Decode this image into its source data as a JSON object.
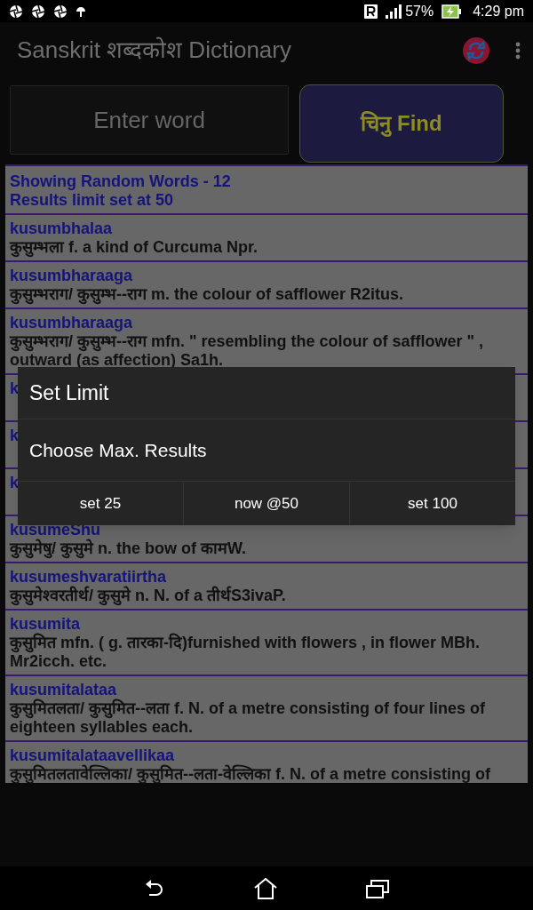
{
  "status_bar": {
    "battery": "57%",
    "time": "4:29 pm"
  },
  "app_bar": {
    "title": "Sanskrit शब्दकोश Dictionary"
  },
  "search": {
    "placeholder": "Enter word"
  },
  "find_button": {
    "label": "चिनु Find"
  },
  "results": {
    "header": [
      "Showing Random Words - 12",
      "Results limit set at 50"
    ],
    "items": [
      {
        "word": "kusumbhalaa",
        "definition": "कुसुम्भला f. a kind of Curcuma Npr."
      },
      {
        "word": "kusumbharaaga",
        "definition": "कुसुम्भराग/ कुसुम्भ--राग m. the colour of safflower R2itus."
      },
      {
        "word": "kusumbharaaga",
        "definition": "कुसुम्भराग/ कुसुम्भ--राग mfn. \" resembling the colour of safflower \" , outward (as affection) Sa1h."
      },
      {
        "word": "k"
      },
      {
        "word": "k"
      },
      {
        "word": "k"
      },
      {
        "word": "kusumeShu",
        "definition": "कुसुमेषु/ कुसुमे n. the bow of कामW."
      },
      {
        "word": "kusumeshvaratiirtha",
        "definition": "कुसुमेश्वरतीर्थ/ कुसुमे n. N. of a तीर्थS3ivaP."
      },
      {
        "word": "kusumita",
        "definition": "कुसुमित mfn. ( g. तारका-दि)furnished with flowers , in flower MBh. Mr2icch. etc."
      },
      {
        "word": "kusumitalataa",
        "definition": "कुसुमितलता/ कुसुमित--लता f. N. of a metre consisting of four lines of eighteen syllables each."
      },
      {
        "word": "kusumitalataavellikaa",
        "definition": "कुसुमितलतावेल्लिका/ कुसुमित--लता-वेल्लिका f. N. of a metre consisting of"
      }
    ]
  },
  "dialog": {
    "title": "Set Limit",
    "message": "Choose Max. Results",
    "buttons": [
      "set 25",
      "now @50",
      "set 100"
    ]
  }
}
